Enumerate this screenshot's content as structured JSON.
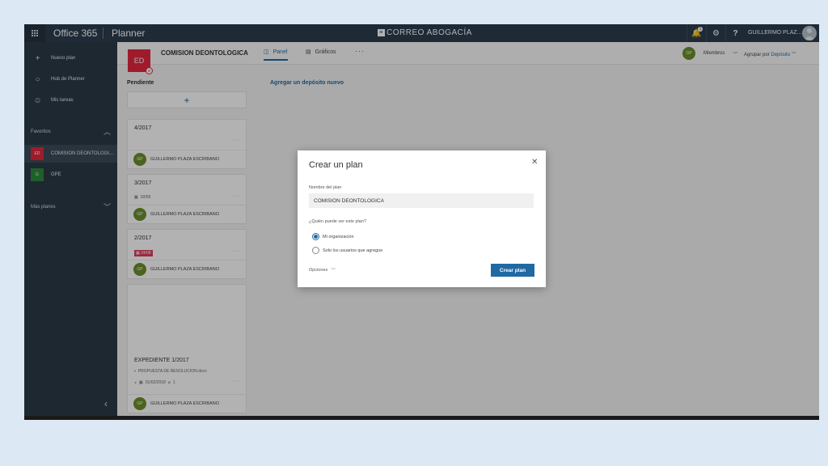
{
  "topbar": {
    "brand": "Office 365",
    "app": "Planner",
    "logo_mark": "≡",
    "logo_text": "CORREO ABOGACÍA",
    "notifications_count": "1",
    "bell": "🔔",
    "settings": "⚙",
    "help": "?",
    "user_name": "GUILLERMO PLAZ..."
  },
  "leftnav": {
    "items": [
      {
        "icon": "+",
        "label": "Nuevo plan"
      },
      {
        "icon": "○",
        "label": "Hub de Planner"
      },
      {
        "icon": "☺",
        "label": "Mis tareas"
      }
    ],
    "favorites_label": "Favoritos",
    "chevron_up": "︿",
    "chevron_down": "﹀",
    "favorites": [
      {
        "abbr": "ED",
        "name": "COMISION DEONTOLOGI...",
        "color": "#e3283f"
      },
      {
        "abbr": "G",
        "name": "GPE",
        "color": "#2c8a3c"
      }
    ],
    "more_plans_label": "Más planes",
    "collapse": "‹"
  },
  "header": {
    "plan_abbr": "ED",
    "plan_group_glyph": "e",
    "plan_title": "COMISION DEONTOLOGICA",
    "tab_panel": "Panel",
    "tab_panel_icon": "◫",
    "tab_graficos": "Gráficos",
    "tab_graficos_icon": "▤",
    "more": "···",
    "member_initials": "GP",
    "members_label": "Miembros",
    "members_chev": "﹀",
    "group_by_prefix": "Agrupar por",
    "group_by_value": "Depósito",
    "group_by_chev": "﹀"
  },
  "board": {
    "bucket_title": "Pendiente",
    "add_task": "+",
    "add_bucket": "Agregar un depósito nuevo",
    "cards": [
      {
        "title": "4/2017",
        "date": "",
        "assignee": "GUILLERMO PLAZA ESCRIBANO",
        "initials": "GP"
      },
      {
        "title": "3/2017",
        "date": "02/09",
        "assignee": "GUILLERMO PLAZA ESCRIBANO",
        "initials": "GP"
      },
      {
        "title": "2/2017",
        "date": "24/08",
        "assignee": "GUILLERMO PLAZA ESCRIBANO",
        "initials": "GP"
      },
      {
        "title": "EXPEDIENTE 1/2017",
        "attachment": "PROPUESTA DE RESOLUCION.docx",
        "date": "01/02/2018",
        "attachments_count": "1",
        "assignee": "GUILLERMO PLAZA ESCRIBANO",
        "initials": "GP"
      }
    ],
    "dots": "···",
    "calendar_icon": "▦",
    "doc_icon": "▪",
    "clip_icon": "⌀",
    "progress_icon": "◒"
  },
  "dialog": {
    "title": "Crear un plan",
    "close": "✕",
    "name_label": "Nombre del plan",
    "name_value": "COMISION DEONTOLOGICA",
    "privacy_question": "¿Quién puede ver este plan?",
    "option_org": "Mi organización",
    "option_members": "Solo los usuarios que agregue",
    "options_label": "Opciones",
    "options_chev": "﹀",
    "submit": "Crear plan"
  }
}
